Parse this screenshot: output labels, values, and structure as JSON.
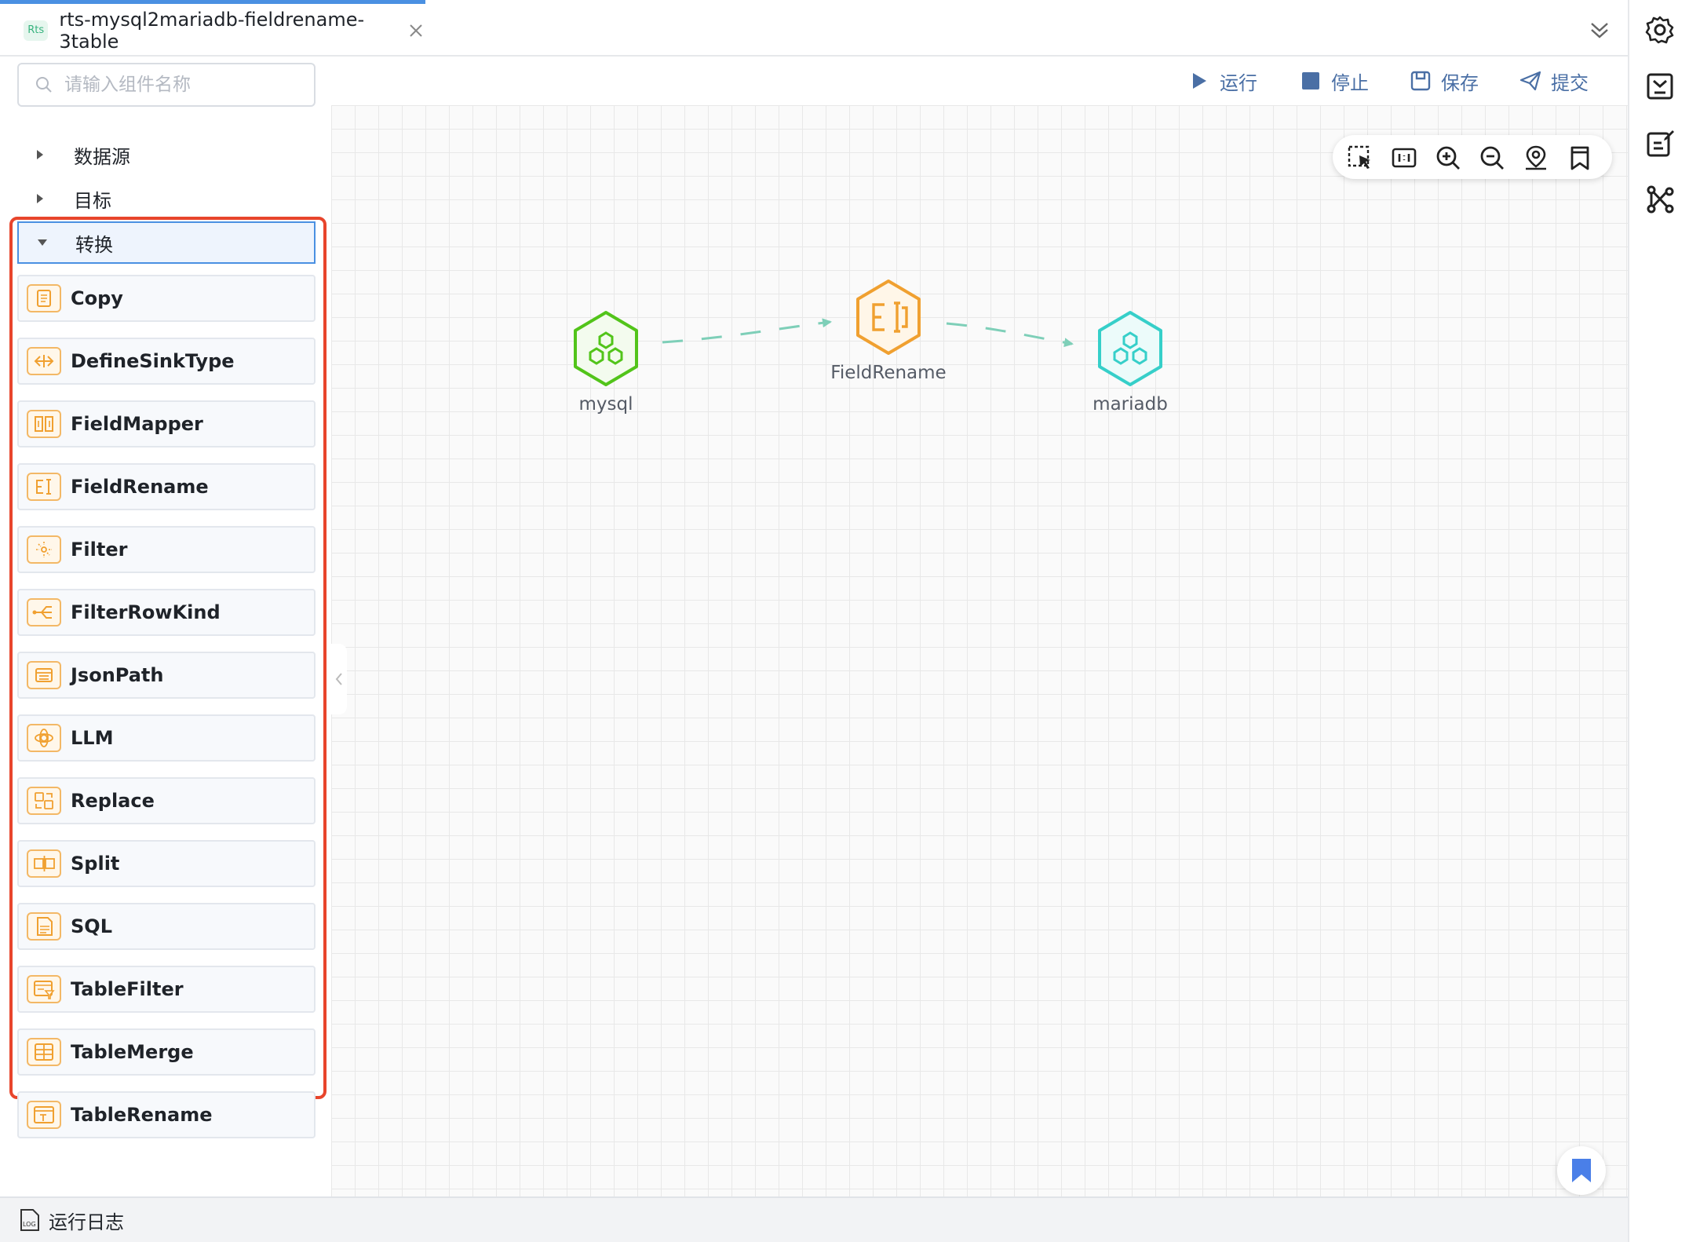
{
  "tab": {
    "badge": "Rts",
    "title": "rts-mysql2mariadb-fieldrename-3table"
  },
  "search": {
    "placeholder": "请输入组件名称",
    "value": ""
  },
  "tree": [
    {
      "label": "数据源",
      "expanded": false
    },
    {
      "label": "目标",
      "expanded": false
    },
    {
      "label": "转换",
      "expanded": true
    }
  ],
  "components": [
    {
      "label": "Copy",
      "icon": "copy-icon"
    },
    {
      "label": "DefineSinkType",
      "icon": "define-sink-type-icon"
    },
    {
      "label": "FieldMapper",
      "icon": "field-mapper-icon"
    },
    {
      "label": "FieldRename",
      "icon": "field-rename-icon"
    },
    {
      "label": "Filter",
      "icon": "filter-icon"
    },
    {
      "label": "FilterRowKind",
      "icon": "filter-row-kind-icon"
    },
    {
      "label": "JsonPath",
      "icon": "json-path-icon"
    },
    {
      "label": "LLM",
      "icon": "llm-icon"
    },
    {
      "label": "Replace",
      "icon": "replace-icon"
    },
    {
      "label": "Split",
      "icon": "split-icon"
    },
    {
      "label": "SQL",
      "icon": "sql-icon"
    },
    {
      "label": "TableFilter",
      "icon": "table-filter-icon"
    },
    {
      "label": "TableMerge",
      "icon": "table-merge-icon"
    },
    {
      "label": "TableRename",
      "icon": "table-rename-icon"
    }
  ],
  "toolbar": {
    "run": "运行",
    "stop": "停止",
    "save": "保存",
    "submit": "提交"
  },
  "graph": {
    "nodes": [
      {
        "id": "mysql",
        "label": "mysql",
        "color": "#52c41a"
      },
      {
        "id": "fieldrename",
        "label": "FieldRename",
        "color": "#f0a030"
      },
      {
        "id": "mariadb",
        "label": "mariadb",
        "color": "#36cfc9"
      }
    ],
    "edges": [
      {
        "from": "mysql",
        "to": "fieldrename"
      },
      {
        "from": "fieldrename",
        "to": "mariadb"
      }
    ],
    "edge_color": "#7ecfb8"
  },
  "log": {
    "label": "运行日志"
  },
  "colors": {
    "accent": "#4a90e2",
    "highlight": "#e8452c",
    "component_icon": "#f3b866"
  }
}
